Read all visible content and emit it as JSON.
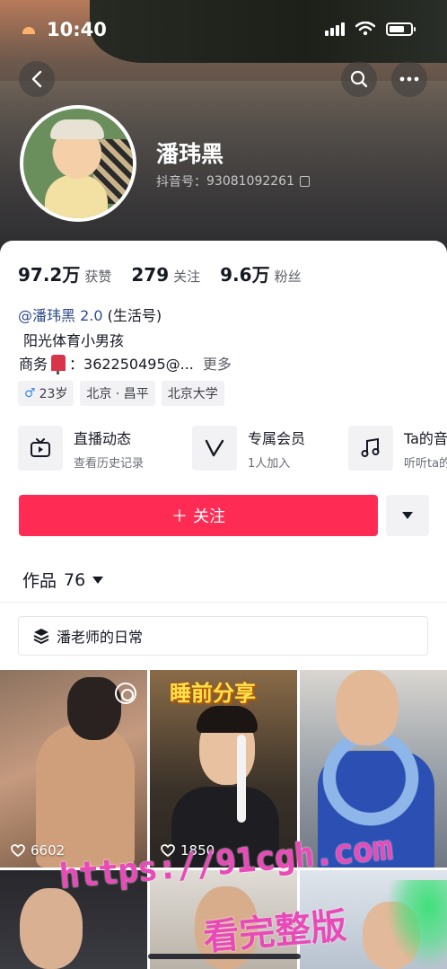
{
  "status_bar": {
    "time": "10:40"
  },
  "profile": {
    "name": "潘玮黑",
    "douyin_id_label": "抖音号：",
    "douyin_id": "93081092261"
  },
  "stats": [
    {
      "value": "97.2万",
      "label": "获赞"
    },
    {
      "value": "279",
      "label": "关注"
    },
    {
      "value": "9.6万",
      "label": "粉丝"
    }
  ],
  "linked_account": {
    "handle": "@潘玮黑 2.0",
    "suffix": "(生活号)"
  },
  "bio": "阳光体育小男孩",
  "business": {
    "label": "商务",
    "value": "：362250495@...",
    "more": "更多"
  },
  "tags": [
    {
      "icon": "male-icon",
      "symbol": "♂",
      "text": "23岁"
    },
    {
      "text": "北京 · 昌平"
    },
    {
      "text": "北京大学"
    }
  ],
  "features": [
    {
      "icon": "live-tv-icon",
      "title": "直播动态",
      "subtitle": "查看历史记录"
    },
    {
      "icon": "v-badge-icon",
      "title": "专属会员",
      "subtitle": "1人加入"
    },
    {
      "icon": "music-note-icon",
      "title": "Ta的音",
      "subtitle": "听听ta的"
    }
  ],
  "follow_button": {
    "plus": "＋",
    "label": "关注"
  },
  "works_tab": {
    "label": "作品",
    "count": "76"
  },
  "collection": {
    "label": "潘老师的日常"
  },
  "videos": [
    {
      "banner": "",
      "likes": "6602"
    },
    {
      "banner": "睡前分享",
      "likes": "1850"
    },
    {
      "banner": "",
      "likes": ""
    }
  ],
  "watermark": {
    "url": "https://91cgh.com",
    "text": "看完整版"
  },
  "colors": {
    "accent": "#fe2c55",
    "link": "#2c4a8a",
    "watermark": "#e84bb8"
  }
}
